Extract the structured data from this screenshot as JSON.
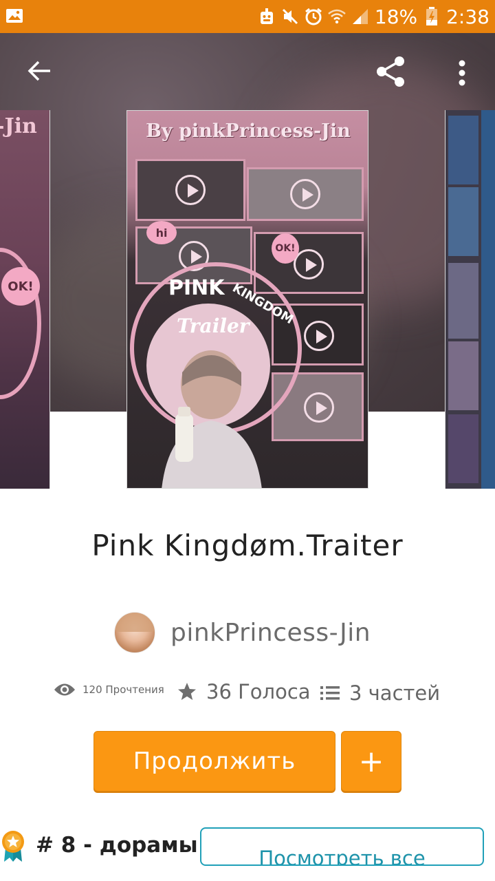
{
  "status_bar": {
    "battery_percent": "18%",
    "clock": "2:38",
    "icons": [
      "image-icon",
      "android-icon",
      "mute-icon",
      "alarm-icon",
      "wifi-icon",
      "signal-icon",
      "battery-charging-icon"
    ]
  },
  "toolbar": {
    "back_icon": "arrow-back-icon",
    "share_icon": "share-icon",
    "more_icon": "more-vert-icon"
  },
  "cover": {
    "title_text": "By pinkPrincess-Jin",
    "label_pink": "PINK",
    "label_kingdom": "KINGDOM",
    "label_trailer": "Trailer",
    "bubble_hi": "hi",
    "bubble_ok": "OK!",
    "left_cover_text": "-Jin",
    "left_cover_bubble": "OK!"
  },
  "story": {
    "title": "Pink Kingdøm.Traiter",
    "author": "pinkPrincess-Jin"
  },
  "stats": {
    "reads_label": "120 Прочтения",
    "votes_label": "36 Голоса",
    "parts_label": "3 частей"
  },
  "actions": {
    "continue_label": "Продолжить",
    "add_label": "+"
  },
  "ranking": {
    "rank_label": "# 8 - дорамы",
    "view_all_label": "Посмотреть все"
  },
  "colors": {
    "status_bar": "#e8820c",
    "accent": "#fb9712",
    "link": "#1e93aa"
  }
}
